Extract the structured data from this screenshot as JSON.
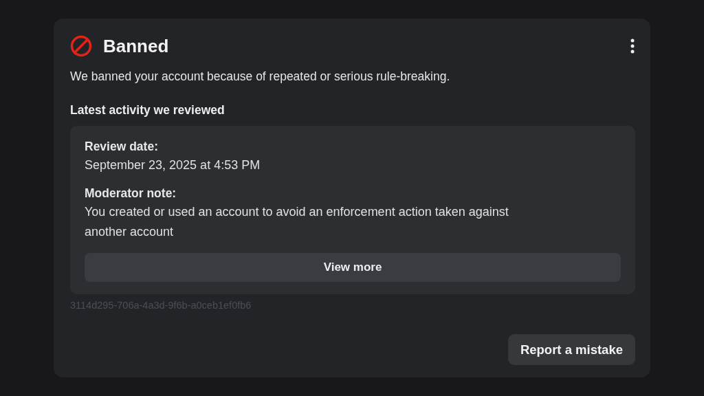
{
  "card": {
    "title": "Banned",
    "description": "We banned your account because of repeated or serious rule-breaking.",
    "section_title": "Latest activity we reviewed",
    "activity": {
      "fields": [
        {
          "label": "Review date:",
          "value": "September 23, 2025 at 4:53 PM"
        },
        {
          "label": "Moderator note:",
          "value": "You created or used an account to avoid an enforcement action taken against another account"
        }
      ],
      "button": "View more"
    },
    "reference_id": "3114d295-706a-4a3d-9f6b-a0ceb1ef0fb6",
    "action": "Report a mistake"
  }
}
